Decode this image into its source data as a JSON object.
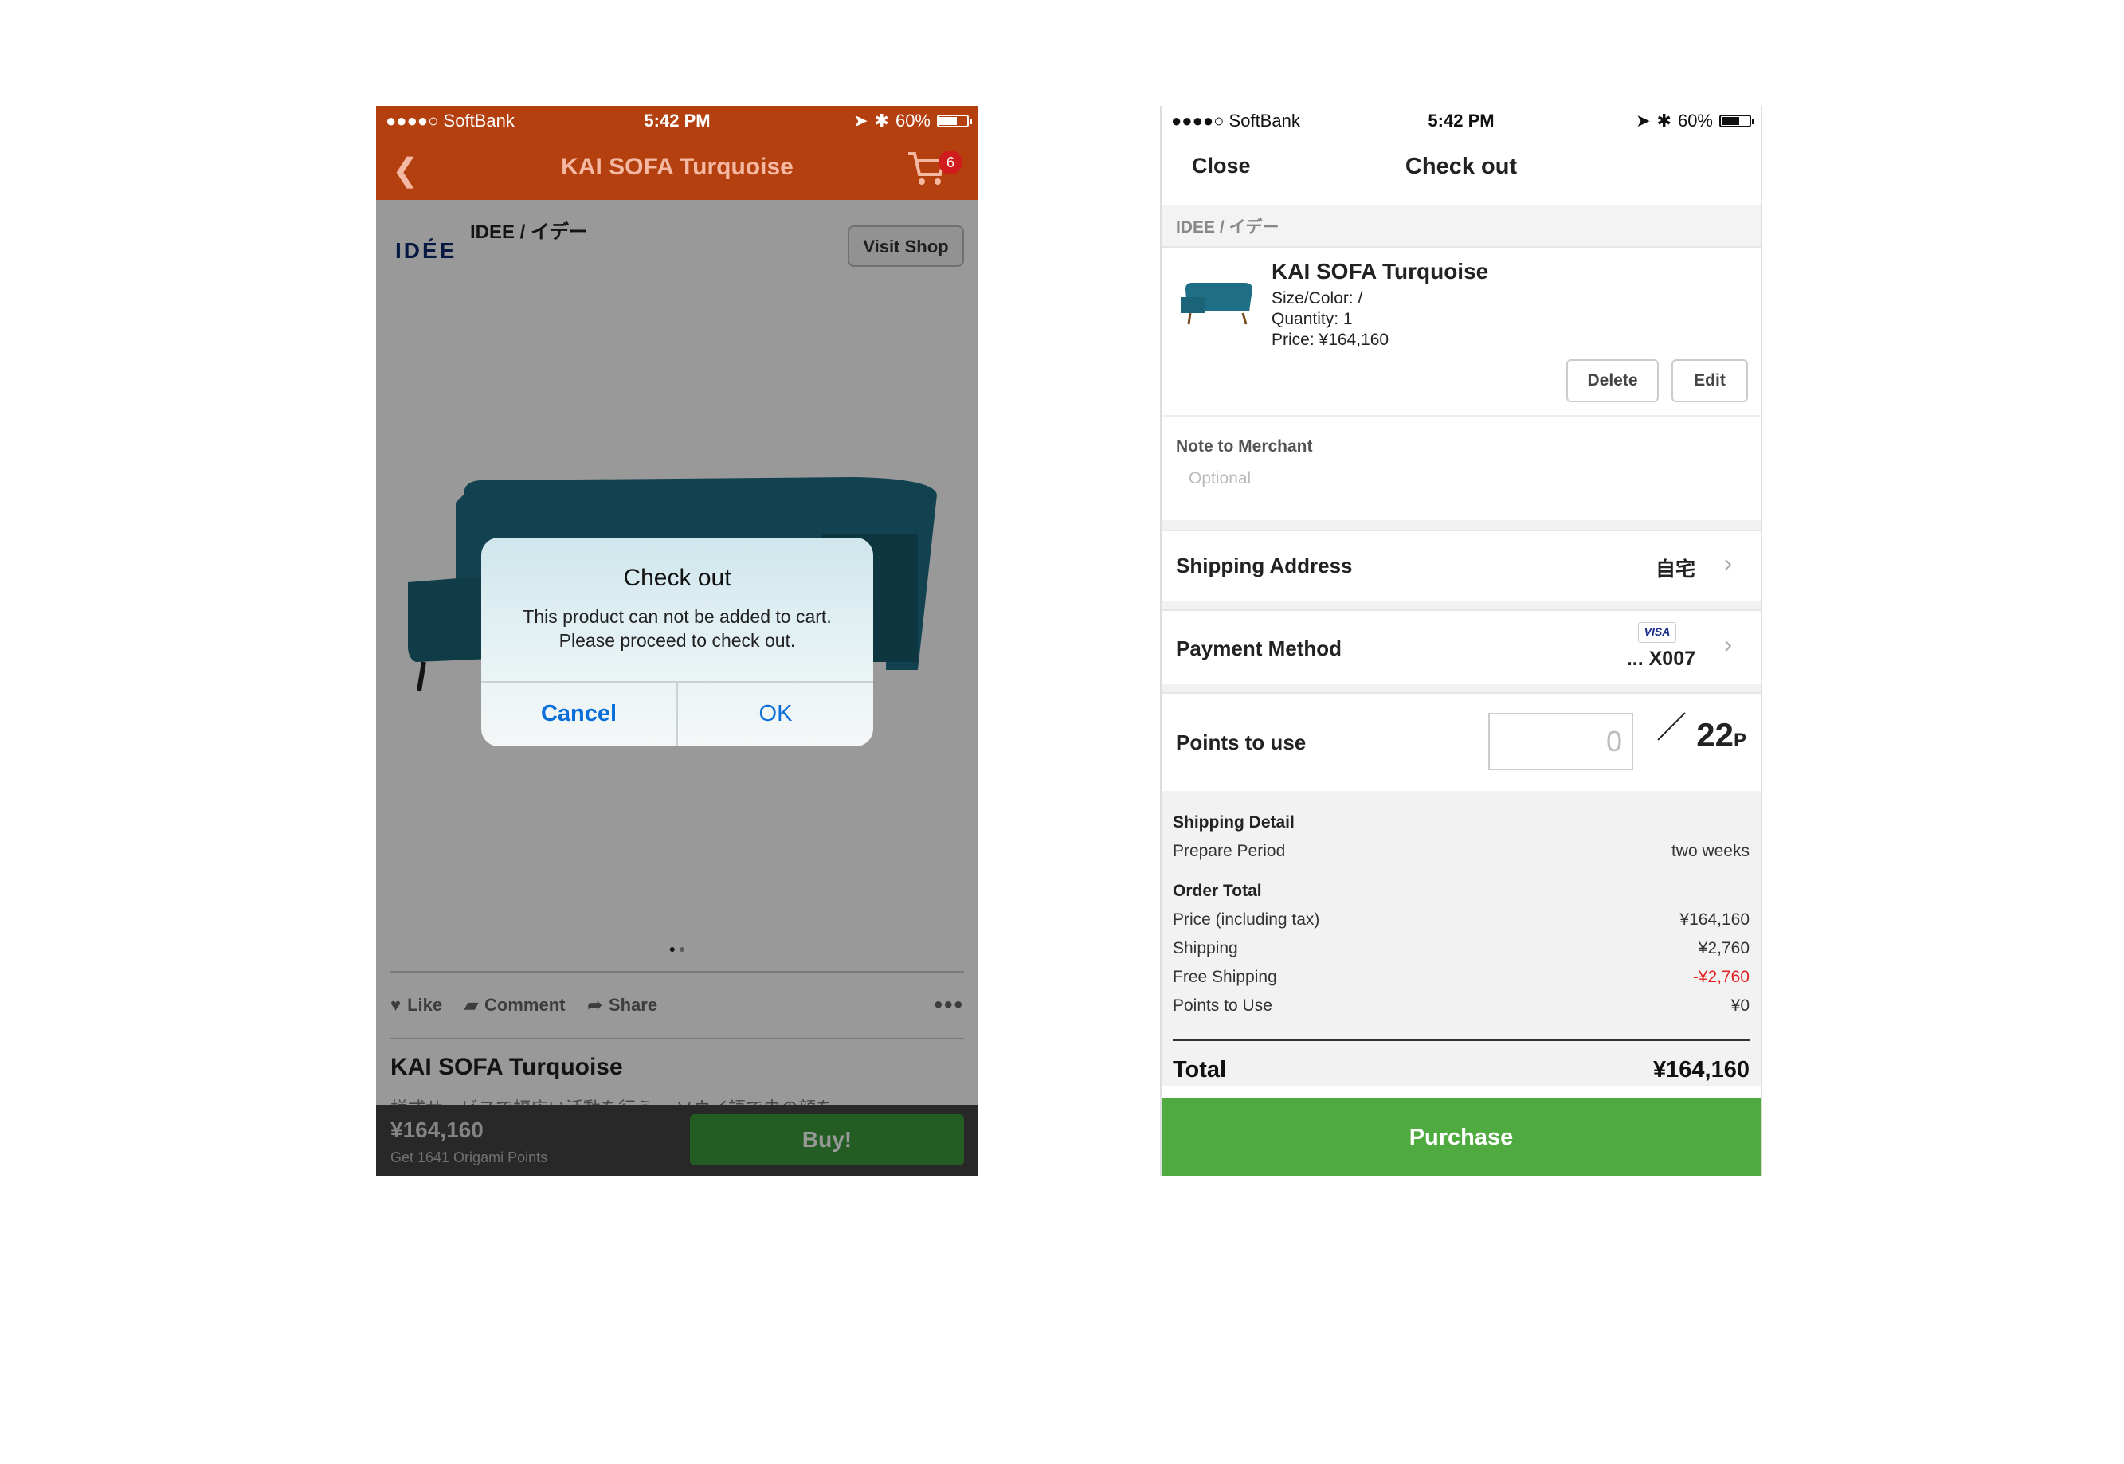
{
  "status_bar": {
    "carrier": "●●●●○ SoftBank",
    "time": "5:42 PM",
    "battery": "60%"
  },
  "left": {
    "header": {
      "title": "KAI SOFA Turquoise",
      "cart_badge": "6",
      "brand_color": "#b5400f"
    },
    "shop": {
      "logo": "IDÉE",
      "name": "IDEE / イデー",
      "visit_label": "Visit Shop"
    },
    "actions": {
      "like": "Like",
      "comment": "Comment",
      "share": "Share",
      "more": "•••"
    },
    "product_title": "KAI SOFA Turquoise",
    "description": "様式サービスで幅広い活動を行う… ソウイ語で虫の顔を",
    "buy_bar": {
      "price": "¥164,160",
      "points": "Get 1641 Origami Points",
      "buy_label": "Buy!"
    },
    "alert": {
      "title": "Check out",
      "message_line1": "This product can not be added to cart.",
      "message_line2": "Please proceed to check out.",
      "cancel": "Cancel",
      "ok": "OK"
    },
    "pager": {
      "count": 2,
      "active": 1
    }
  },
  "right": {
    "nav": {
      "close": "Close",
      "title": "Check out"
    },
    "shop_name": "IDEE / イデー",
    "item": {
      "name": "KAI SOFA Turquoise",
      "size_color": "Size/Color: /",
      "quantity": "Quantity: 1",
      "price": "Price: ¥164,160",
      "delete": "Delete",
      "edit": "Edit"
    },
    "note": {
      "label": "Note to Merchant",
      "placeholder": "Optional"
    },
    "shipping_address": {
      "label": "Shipping Address",
      "value": "自宅"
    },
    "payment": {
      "label": "Payment Method",
      "card_brand": "VISA",
      "value": "... X007"
    },
    "points": {
      "label": "Points to use",
      "input_value": "0",
      "available": "22",
      "unit": "P"
    },
    "shipping_detail": {
      "heading": "Shipping Detail",
      "prepare_label": "Prepare Period",
      "prepare_value": "two weeks"
    },
    "order_total": {
      "heading": "Order Total",
      "lines": [
        {
          "label": "Price (including tax)",
          "value": "¥164,160"
        },
        {
          "label": "Shipping",
          "value": "¥2,760"
        },
        {
          "label": "Free Shipping",
          "value": "-¥2,760"
        },
        {
          "label": "Points to Use",
          "value": "¥0"
        }
      ]
    },
    "total": {
      "label": "Total",
      "value": "¥164,160"
    },
    "purchase_label": "Purchase",
    "accent_color": "#4faa3f"
  }
}
